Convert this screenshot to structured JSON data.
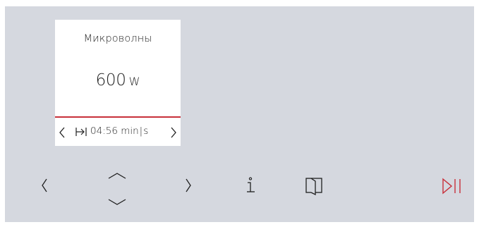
{
  "program": {
    "title": "Микроволны",
    "power_value": "600",
    "power_unit": "W",
    "time": "04:56",
    "time_unit_min": "min",
    "time_unit_s": "s"
  },
  "icons": {
    "prev": "chevron-left-icon",
    "next": "chevron-right-icon",
    "timer": "duration-icon",
    "up": "chevron-up-icon",
    "down": "chevron-down-icon",
    "info": "info-icon",
    "door": "door-icon",
    "start_pause": "play-pause-icon"
  },
  "colors": {
    "background": "#d5d8df",
    "card": "#ffffff",
    "accent": "#c8303a",
    "text": "#1f1f1f"
  }
}
